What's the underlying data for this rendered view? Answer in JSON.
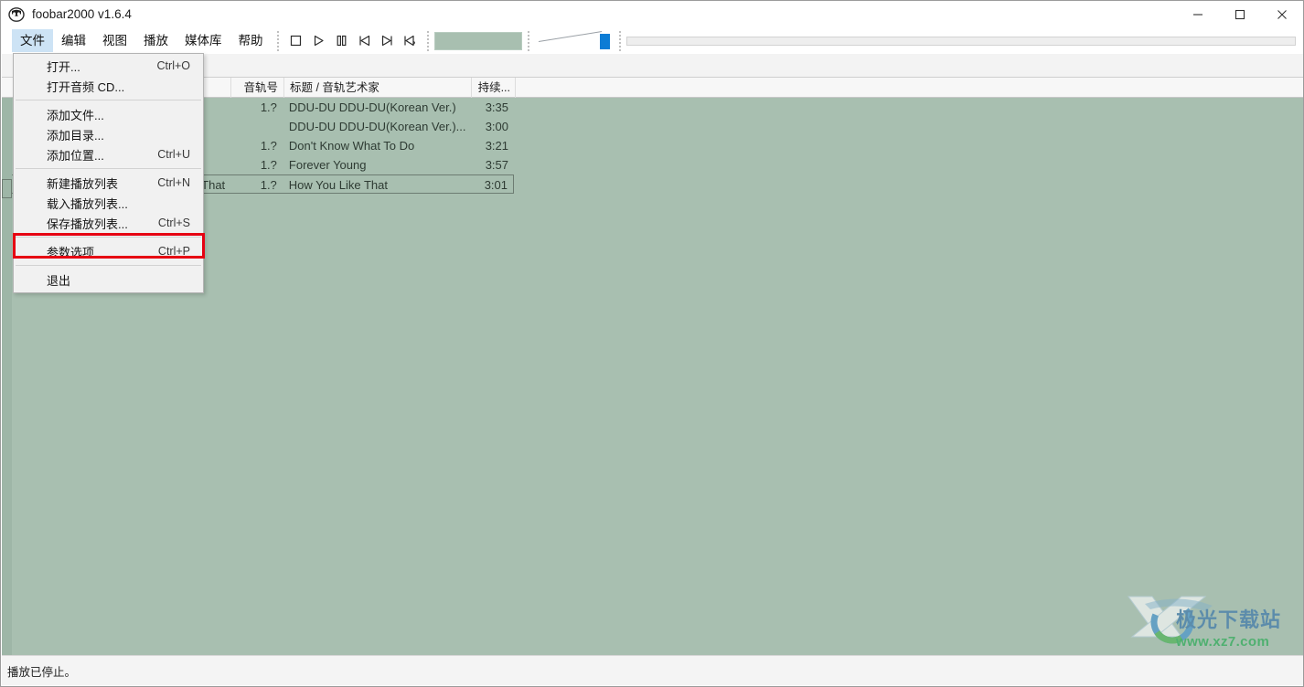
{
  "window": {
    "title": "foobar2000 v1.6.4",
    "icon": "foobar-logo-icon",
    "minimize": "−",
    "maximize": "□",
    "close": "✕"
  },
  "menubar": {
    "items": [
      {
        "label": "文件",
        "active": true
      },
      {
        "label": "编辑",
        "active": false
      },
      {
        "label": "视图",
        "active": false
      },
      {
        "label": "播放",
        "active": false
      },
      {
        "label": "媒体库",
        "active": false
      },
      {
        "label": "帮助",
        "active": false
      }
    ]
  },
  "toolbar": {
    "buttons": [
      {
        "name": "stop-button",
        "glyph": "stop"
      },
      {
        "name": "play-button",
        "glyph": "play"
      },
      {
        "name": "pause-button",
        "glyph": "pause"
      },
      {
        "name": "previous-button",
        "glyph": "prev"
      },
      {
        "name": "next-button",
        "glyph": "next"
      },
      {
        "name": "random-button",
        "glyph": "random"
      }
    ],
    "display_text": "",
    "volume_value": 100,
    "seek_value": 0
  },
  "file_menu": {
    "groups": [
      [
        {
          "label": "打开...",
          "accel": "Ctrl+O",
          "name": "menu-open"
        },
        {
          "label": "打开音频 CD...",
          "accel": "",
          "name": "menu-open-audio-cd"
        }
      ],
      [
        {
          "label": "添加文件...",
          "accel": "",
          "name": "menu-add-files"
        },
        {
          "label": "添加目录...",
          "accel": "",
          "name": "menu-add-folder"
        },
        {
          "label": "添加位置...",
          "accel": "Ctrl+U",
          "name": "menu-add-location"
        }
      ],
      [
        {
          "label": "新建播放列表",
          "accel": "Ctrl+N",
          "name": "menu-new-playlist"
        },
        {
          "label": "载入播放列表...",
          "accel": "",
          "name": "menu-load-playlist"
        },
        {
          "label": "保存播放列表...",
          "accel": "Ctrl+S",
          "name": "menu-save-playlist"
        }
      ],
      [
        {
          "label": "参数选项",
          "accel": "Ctrl+P",
          "name": "menu-preferences",
          "highlighted": true
        }
      ],
      [
        {
          "label": "退出",
          "accel": "",
          "name": "menu-exit"
        }
      ]
    ]
  },
  "playlist": {
    "columns": [
      {
        "label": "",
        "name": "column-index"
      },
      {
        "label": "",
        "name": "column-artist-album"
      },
      {
        "label": "音轨号",
        "name": "column-track-number"
      },
      {
        "label": "标题 / 音轨艺术家",
        "name": "column-title-artist"
      },
      {
        "label": "持续...",
        "name": "column-duration"
      },
      {
        "label": "",
        "name": "column-extra"
      }
    ],
    "rows": [
      {
        "index": "",
        "artist": "",
        "track": "1.?",
        "title": "DDU-DU DDU-DU(Korean Ver.)",
        "duration": "3:35",
        "focused": false
      },
      {
        "index": "",
        "artist": "",
        "track": "",
        "title": "DDU-DU DDU-DU(Korean Ver.)...",
        "duration": "3:00",
        "focused": false
      },
      {
        "index": "",
        "artist": "",
        "track": "1.?",
        "title": "Don't Know What To Do",
        "duration": "3:21",
        "focused": false
      },
      {
        "index": "",
        "artist": "",
        "track": "1.?",
        "title": "Forever Young",
        "duration": "3:57",
        "focused": false
      },
      {
        "index": "",
        "artist": "That",
        "track": "1.?",
        "title": "How You Like That",
        "duration": "3:01",
        "focused": true
      }
    ]
  },
  "statusbar": {
    "text": "播放已停止。"
  },
  "watermark": {
    "site_name": "极光下载站",
    "url": "www.xz7.com"
  },
  "colors": {
    "playlist_background": "#a8bfb0",
    "menu_active": "#cde3f5",
    "highlight_border": "#e60012",
    "volume_handle": "#0c7cd5"
  }
}
